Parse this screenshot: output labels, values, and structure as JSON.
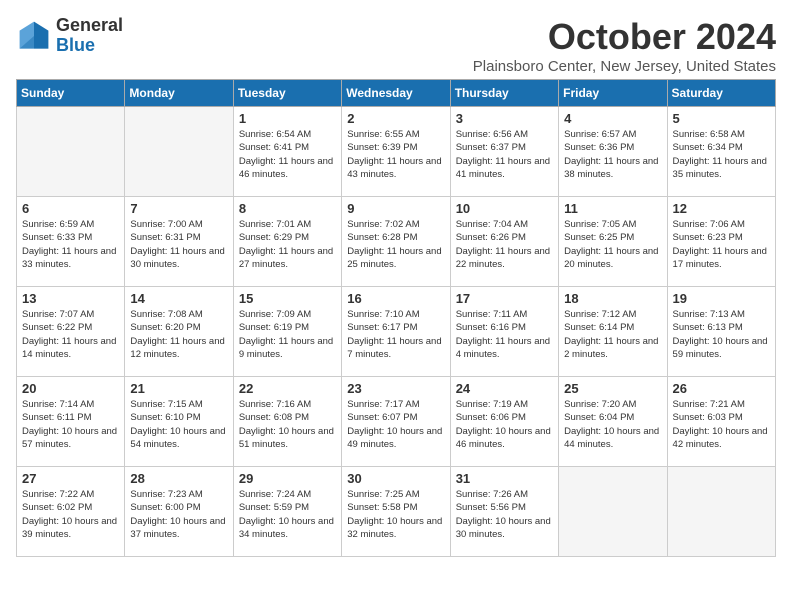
{
  "logo": {
    "general": "General",
    "blue": "Blue"
  },
  "title": "October 2024",
  "location": "Plainsboro Center, New Jersey, United States",
  "days_header": [
    "Sunday",
    "Monday",
    "Tuesday",
    "Wednesday",
    "Thursday",
    "Friday",
    "Saturday"
  ],
  "weeks": [
    [
      {
        "num": "",
        "info": ""
      },
      {
        "num": "",
        "info": ""
      },
      {
        "num": "1",
        "info": "Sunrise: 6:54 AM\nSunset: 6:41 PM\nDaylight: 11 hours and 46 minutes."
      },
      {
        "num": "2",
        "info": "Sunrise: 6:55 AM\nSunset: 6:39 PM\nDaylight: 11 hours and 43 minutes."
      },
      {
        "num": "3",
        "info": "Sunrise: 6:56 AM\nSunset: 6:37 PM\nDaylight: 11 hours and 41 minutes."
      },
      {
        "num": "4",
        "info": "Sunrise: 6:57 AM\nSunset: 6:36 PM\nDaylight: 11 hours and 38 minutes."
      },
      {
        "num": "5",
        "info": "Sunrise: 6:58 AM\nSunset: 6:34 PM\nDaylight: 11 hours and 35 minutes."
      }
    ],
    [
      {
        "num": "6",
        "info": "Sunrise: 6:59 AM\nSunset: 6:33 PM\nDaylight: 11 hours and 33 minutes."
      },
      {
        "num": "7",
        "info": "Sunrise: 7:00 AM\nSunset: 6:31 PM\nDaylight: 11 hours and 30 minutes."
      },
      {
        "num": "8",
        "info": "Sunrise: 7:01 AM\nSunset: 6:29 PM\nDaylight: 11 hours and 27 minutes."
      },
      {
        "num": "9",
        "info": "Sunrise: 7:02 AM\nSunset: 6:28 PM\nDaylight: 11 hours and 25 minutes."
      },
      {
        "num": "10",
        "info": "Sunrise: 7:04 AM\nSunset: 6:26 PM\nDaylight: 11 hours and 22 minutes."
      },
      {
        "num": "11",
        "info": "Sunrise: 7:05 AM\nSunset: 6:25 PM\nDaylight: 11 hours and 20 minutes."
      },
      {
        "num": "12",
        "info": "Sunrise: 7:06 AM\nSunset: 6:23 PM\nDaylight: 11 hours and 17 minutes."
      }
    ],
    [
      {
        "num": "13",
        "info": "Sunrise: 7:07 AM\nSunset: 6:22 PM\nDaylight: 11 hours and 14 minutes."
      },
      {
        "num": "14",
        "info": "Sunrise: 7:08 AM\nSunset: 6:20 PM\nDaylight: 11 hours and 12 minutes."
      },
      {
        "num": "15",
        "info": "Sunrise: 7:09 AM\nSunset: 6:19 PM\nDaylight: 11 hours and 9 minutes."
      },
      {
        "num": "16",
        "info": "Sunrise: 7:10 AM\nSunset: 6:17 PM\nDaylight: 11 hours and 7 minutes."
      },
      {
        "num": "17",
        "info": "Sunrise: 7:11 AM\nSunset: 6:16 PM\nDaylight: 11 hours and 4 minutes."
      },
      {
        "num": "18",
        "info": "Sunrise: 7:12 AM\nSunset: 6:14 PM\nDaylight: 11 hours and 2 minutes."
      },
      {
        "num": "19",
        "info": "Sunrise: 7:13 AM\nSunset: 6:13 PM\nDaylight: 10 hours and 59 minutes."
      }
    ],
    [
      {
        "num": "20",
        "info": "Sunrise: 7:14 AM\nSunset: 6:11 PM\nDaylight: 10 hours and 57 minutes."
      },
      {
        "num": "21",
        "info": "Sunrise: 7:15 AM\nSunset: 6:10 PM\nDaylight: 10 hours and 54 minutes."
      },
      {
        "num": "22",
        "info": "Sunrise: 7:16 AM\nSunset: 6:08 PM\nDaylight: 10 hours and 51 minutes."
      },
      {
        "num": "23",
        "info": "Sunrise: 7:17 AM\nSunset: 6:07 PM\nDaylight: 10 hours and 49 minutes."
      },
      {
        "num": "24",
        "info": "Sunrise: 7:19 AM\nSunset: 6:06 PM\nDaylight: 10 hours and 46 minutes."
      },
      {
        "num": "25",
        "info": "Sunrise: 7:20 AM\nSunset: 6:04 PM\nDaylight: 10 hours and 44 minutes."
      },
      {
        "num": "26",
        "info": "Sunrise: 7:21 AM\nSunset: 6:03 PM\nDaylight: 10 hours and 42 minutes."
      }
    ],
    [
      {
        "num": "27",
        "info": "Sunrise: 7:22 AM\nSunset: 6:02 PM\nDaylight: 10 hours and 39 minutes."
      },
      {
        "num": "28",
        "info": "Sunrise: 7:23 AM\nSunset: 6:00 PM\nDaylight: 10 hours and 37 minutes."
      },
      {
        "num": "29",
        "info": "Sunrise: 7:24 AM\nSunset: 5:59 PM\nDaylight: 10 hours and 34 minutes."
      },
      {
        "num": "30",
        "info": "Sunrise: 7:25 AM\nSunset: 5:58 PM\nDaylight: 10 hours and 32 minutes."
      },
      {
        "num": "31",
        "info": "Sunrise: 7:26 AM\nSunset: 5:56 PM\nDaylight: 10 hours and 30 minutes."
      },
      {
        "num": "",
        "info": ""
      },
      {
        "num": "",
        "info": ""
      }
    ]
  ]
}
